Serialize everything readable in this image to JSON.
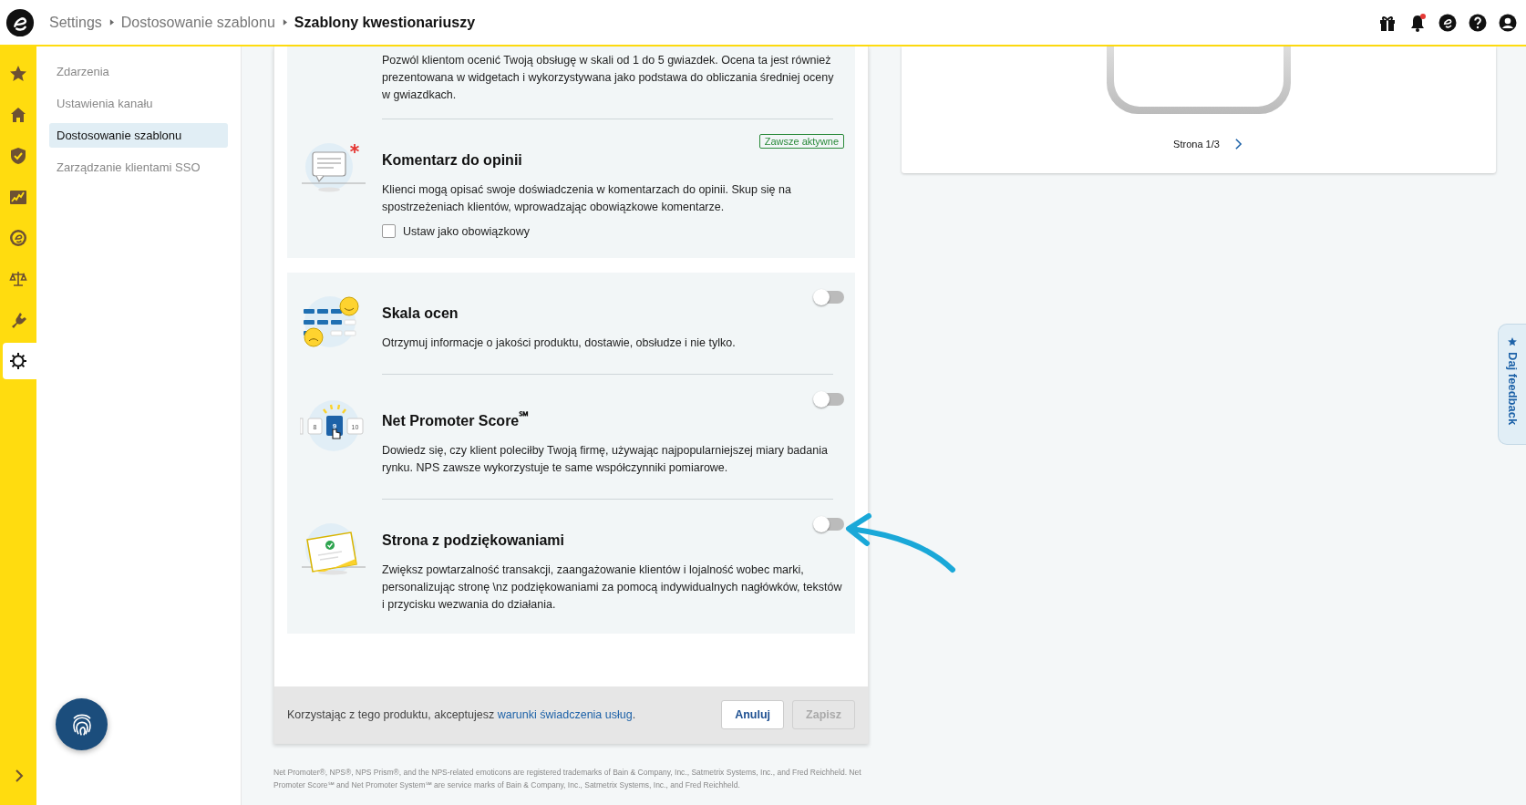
{
  "header": {
    "breadcrumbs": [
      {
        "label": "Settings",
        "current": false
      },
      {
        "label": "Dostosowanie szablonu",
        "current": false
      },
      {
        "label": "Szablony kwestionariuszy",
        "current": true
      }
    ],
    "bell_unread": true
  },
  "rail": {
    "items": [
      {
        "selected": false
      },
      {
        "selected": false
      },
      {
        "selected": false
      },
      {
        "selected": false
      },
      {
        "selected": false
      },
      {
        "selected": false
      },
      {
        "selected": false
      },
      {
        "selected": true
      }
    ]
  },
  "side_nav": {
    "items": [
      {
        "label": "Zdarzenia",
        "selected": false
      },
      {
        "label": "Ustawienia kanału",
        "selected": false
      },
      {
        "label": "Dostosowanie szablonu",
        "selected": true
      },
      {
        "label": "Zarządzanie klientami SSO",
        "selected": false
      }
    ]
  },
  "intro_text": "Pozwól klientom ocenić Twoją obsługę w skali od 1 do 5 gwiazdek. Ocena ta jest również prezentowana w widgetach i wykorzystywana jako podstawa do obliczania średniej oceny w gwiazdkach.",
  "comment_section": {
    "title": "Komentarz do opinii",
    "badge": "Zawsze aktywne",
    "description": "Klienci mogą opisać swoje doświadczenia w komentarzach do opinii. Skup się na spostrzeżeniach klientów, wprowadzając obowiązkowe komentarze.",
    "checkbox": {
      "label": "Ustaw jako obowiązkowy",
      "checked": false
    }
  },
  "features": [
    {
      "title": "Skala ocen",
      "description": "Otrzymuj informacje o jakości produktu, dostawie, obsłudze i nie tylko.",
      "on": false
    },
    {
      "title": "Net Promoter Score$^{℠}$",
      "description": "Dowiedz się, czy klient poleciłby Twoją firmę, używając najpopularniejszej miary badania rynku. NPS zawsze wykorzystuje te same współczynniki pomiarowe.",
      "on": false
    },
    {
      "title": "Strona z podziękowaniami",
      "description": "Zwiększ powtarzalność transakcji, zaangażowanie klientów i lojalność wobec marki, personalizując stronę \\nz podziękowaniami za pomocą indywidualnych nagłówków, tekstów i przycisku wezwania do działania.",
      "on": false
    }
  ],
  "nps_drawing": {
    "scores": [
      "8",
      "9",
      "10"
    ]
  },
  "footer": {
    "terms_text": "Korzystając z tego produktu, akceptujesz",
    "terms_link": "warunki świadczenia usług",
    "terms_end": ".",
    "buttons": [
      {
        "label": "Anuluj",
        "disabled": false
      },
      {
        "label": "Zapisz",
        "disabled": true
      }
    ]
  },
  "legal_text": "Net Promoter®, NPS®, NPS Prism®, and the NPS-related emoticons are registered trademarks of Bain & Company, Inc., Satmetrix Systems, Inc., and Fred Reichheld. Net Promoter Score℠ and Net Promoter System℠ are service marks of Bain & Company, Inc., Satmetrix Systems, Inc., and Fred Reichheld.",
  "preview": {
    "page_label": "Strona 1/3"
  },
  "feedback_tab": {
    "label": "Daj feedback"
  }
}
